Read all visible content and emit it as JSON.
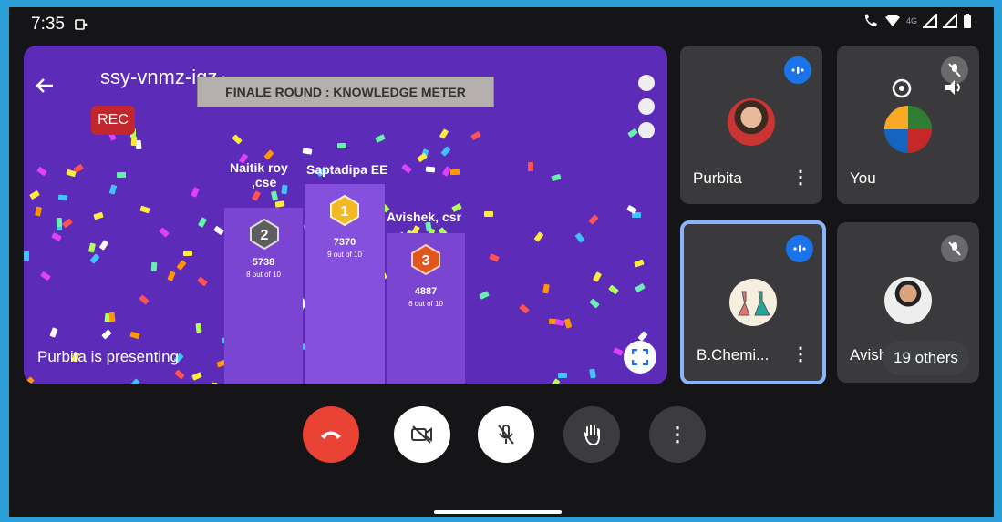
{
  "status_bar": {
    "time": "7:35",
    "network_label": "4G"
  },
  "meeting": {
    "code": "ssy-vnmz-iqz",
    "rec_label": "REC"
  },
  "presentation": {
    "banner": "FINALE ROUND : KNOWLEDGE METER",
    "presenting_text": "Purbita is presenting",
    "leaderboard": [
      {
        "rank": "2",
        "name_line1": "Naitik roy",
        "name_line2": ",cse",
        "score": "5738",
        "detail": "8 out of 10",
        "badge_color": "#757575"
      },
      {
        "rank": "1",
        "name_line1": "Saptadipa EE",
        "name_line2": "",
        "score": "7370",
        "detail": "9 out of 10",
        "badge_color": "#f2b826"
      },
      {
        "rank": "3",
        "name_line1": "Avishek, csr",
        "name_line2": "",
        "score": "4887",
        "detail": "6 out of 10",
        "badge_color": "#e0561c"
      }
    ]
  },
  "participants": [
    {
      "name": "Purbita",
      "speaking": true
    },
    {
      "name": "You",
      "muted": true
    },
    {
      "name": "B.Chemi...",
      "speaking": true,
      "active": true
    },
    {
      "name": "Avish",
      "muted": true
    }
  ],
  "others_label": "19 others",
  "controls": {
    "end_call_color": "#ea4335",
    "button_color": "#ffffff",
    "dark_button_color": "#3c3c3e"
  }
}
